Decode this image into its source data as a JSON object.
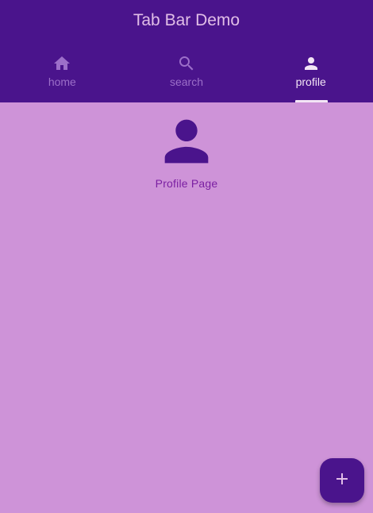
{
  "app": {
    "title": "Tab Bar Demo"
  },
  "tabs": [
    {
      "label": "home",
      "icon": "home-icon",
      "selected": false
    },
    {
      "label": "search",
      "icon": "search-icon",
      "selected": false
    },
    {
      "label": "profile",
      "icon": "person-icon",
      "selected": true
    }
  ],
  "content": {
    "icon": "person-icon",
    "text": "Profile Page"
  },
  "fab": {
    "icon": "add-icon"
  },
  "colors": {
    "appbar": "#4A148C",
    "background": "#CE93D8",
    "tab_active": "#F3E5F5",
    "tab_inactive": "#9C6FC9",
    "content_text": "#7B1FA2"
  }
}
